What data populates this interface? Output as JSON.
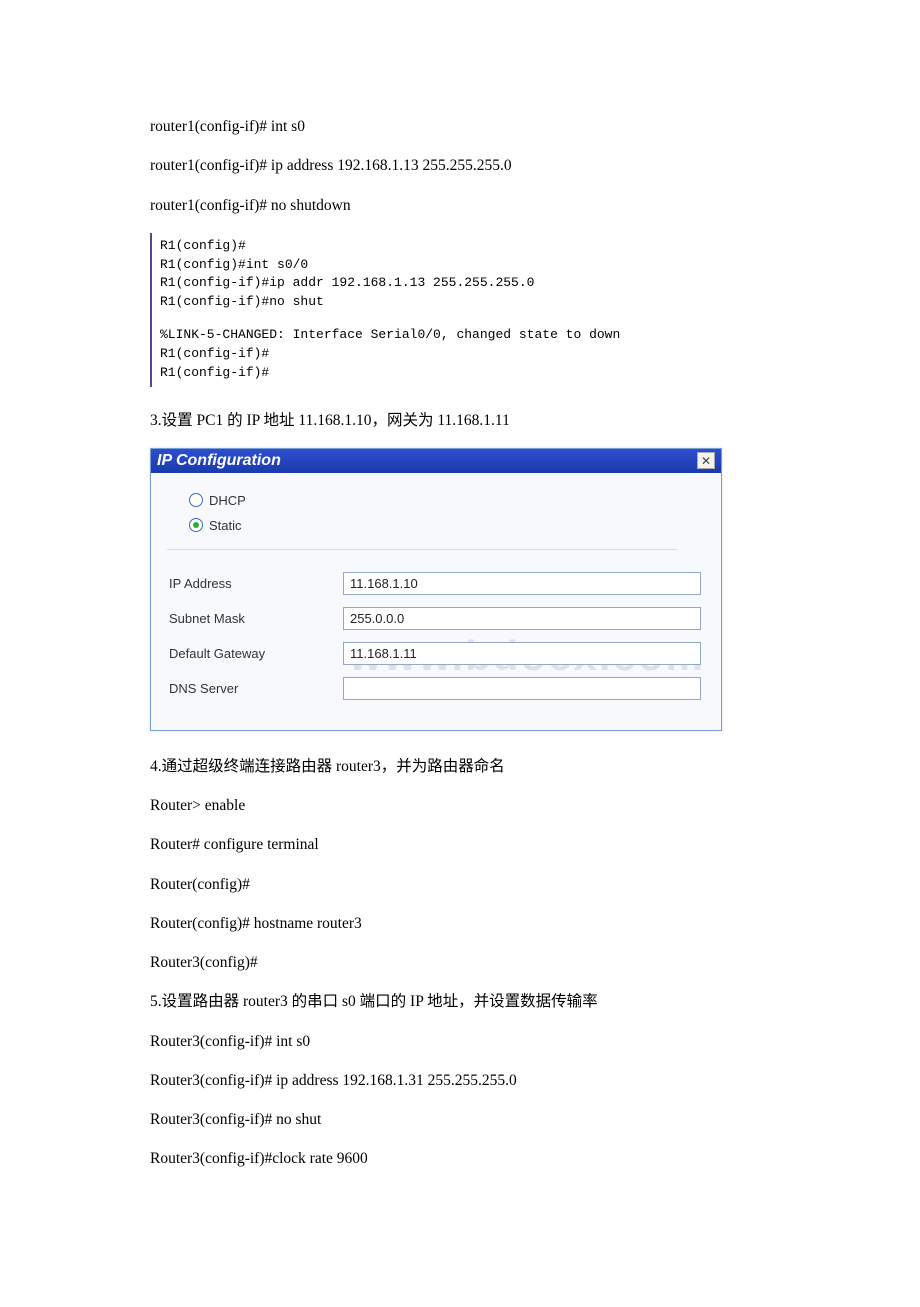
{
  "intro_lines": {
    "l1": "router1(config-if)# int s0",
    "l2": "router1(config-if)# ip address 192.168.1.13 255.255.255.0",
    "l3": "router1(config-if)# no shutdown"
  },
  "terminal": {
    "l1": "R1(config)#",
    "l2": "R1(config)#int s0/0",
    "l3": "R1(config-if)#ip addr 192.168.1.13 255.255.255.0",
    "l4": "R1(config-if)#no shut",
    "l5": "%LINK-5-CHANGED: Interface Serial0/0, changed state to down",
    "l6": "R1(config-if)#",
    "l7": "R1(config-if)#"
  },
  "step3_text": "3.设置 PC1 的 IP 地址 11.168.1.10，网关为 11.168.1.11",
  "ipconfig": {
    "title": "IP Configuration",
    "close": "✕",
    "radios": {
      "dhcp": "DHCP",
      "static": "Static",
      "selected": "static"
    },
    "fields": {
      "ip_label": "IP Address",
      "ip_value": "11.168.1.10",
      "mask_label": "Subnet Mask",
      "mask_value": "255.0.0.0",
      "gw_label": "Default Gateway",
      "gw_value": "11.168.1.11",
      "dns_label": "DNS Server",
      "dns_value": ""
    }
  },
  "watermark": "www.bdocx.com",
  "after_lines": {
    "l1": "4.通过超级终端连接路由器 router3，并为路由器命名",
    "l2": "Router> enable",
    "l3": "Router# configure terminal",
    "l4": "Router(config)#",
    "l5": "Router(config)# hostname router3",
    "l6": "Router3(config)#",
    "l7": "5.设置路由器 router3 的串口 s0 端口的 IP 地址，并设置数据传输率",
    "l8": "Router3(config-if)# int s0",
    "l9": "Router3(config-if)# ip address 192.168.1.31 255.255.255.0",
    "l10": "Router3(config-if)# no shut",
    "l11": "Router3(config-if)#clock rate 9600"
  }
}
